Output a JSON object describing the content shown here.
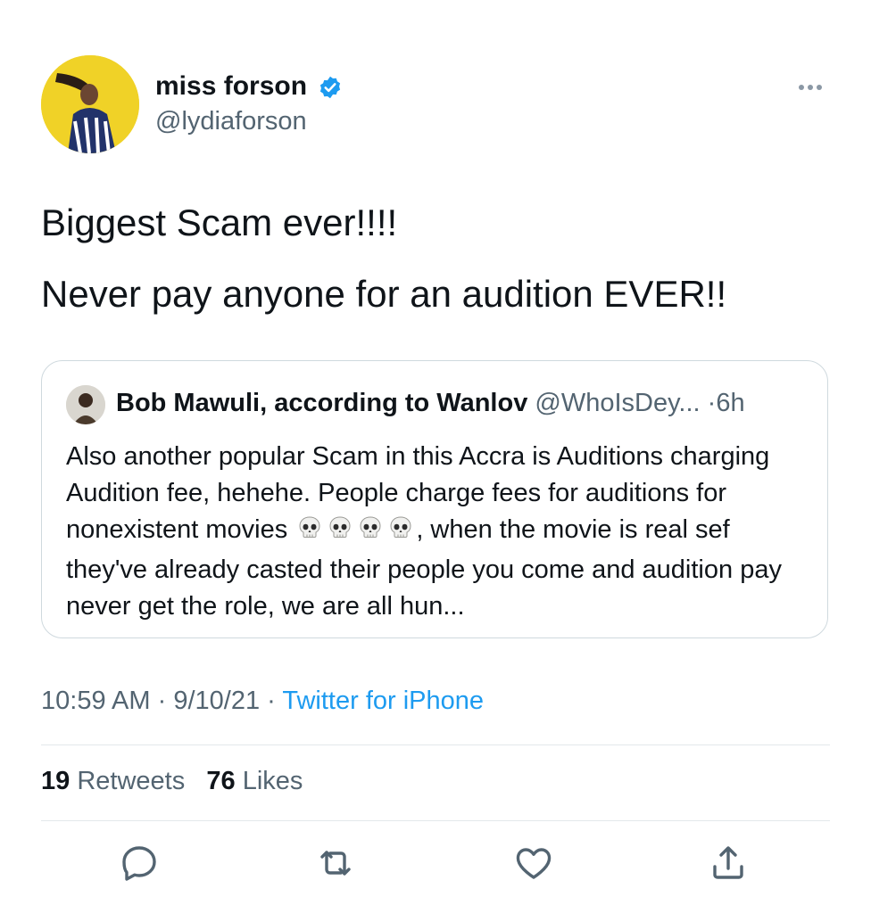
{
  "author": {
    "name": "miss forson",
    "handle": "@lydiaforson",
    "verified": true
  },
  "tweet": {
    "lines": [
      "Biggest Scam ever!!!!",
      "Never pay anyone for an audition EVER!!"
    ]
  },
  "quote": {
    "name": "Bob Mawuli, according to Wanlov",
    "handle": "@WhoIsDey...",
    "separator": "·",
    "time": "6h",
    "body_before": "Also another popular Scam in this Accra is Auditions charging Audition fee, hehehe. People charge fees for auditions for nonexistent movies",
    "body_after": ", when the movie is real sef they've already casted their people you come and audition pay never get the role, we are all hun...",
    "emoji_name": "skull-emoji",
    "emoji_count": 4
  },
  "meta": {
    "time": "10:59 AM",
    "dot1": "·",
    "date": "9/10/21",
    "dot2": "·",
    "source": "Twitter for iPhone"
  },
  "stats": {
    "retweets_count": "19",
    "retweets_label": "Retweets",
    "likes_count": "76",
    "likes_label": "Likes"
  },
  "actions": {
    "reply_icon": "reply-icon",
    "retweet_icon": "retweet-icon",
    "like_icon": "like-icon",
    "share_icon": "share-icon"
  },
  "colors": {
    "link": "#1d9bf0",
    "secondary_text": "#536471",
    "avatar_bg": "#f0d227"
  }
}
